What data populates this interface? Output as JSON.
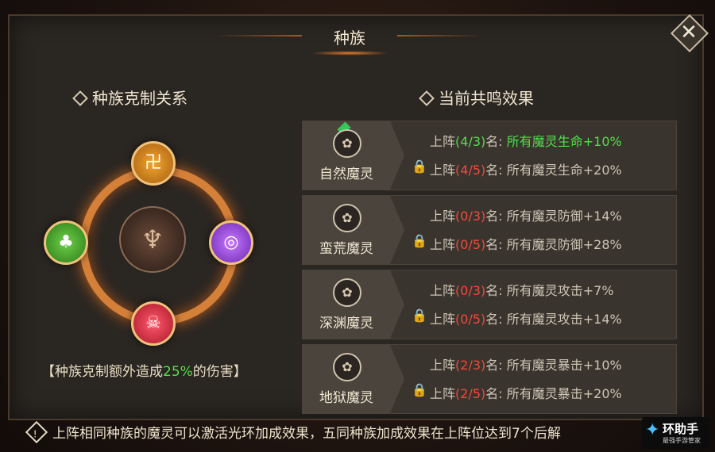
{
  "header": {
    "title": "种族",
    "close_icon": "✕"
  },
  "left_section": {
    "title": "种族克制关系",
    "nodes": [
      {
        "name": "top-race-node",
        "icon": "hell-icon",
        "glyph": "卍"
      },
      {
        "name": "left-race-node",
        "icon": "nature-icon",
        "glyph": "♣"
      },
      {
        "name": "right-race-node",
        "icon": "abyss-icon",
        "glyph": "◎"
      },
      {
        "name": "bottom-race-node",
        "icon": "skull-icon",
        "glyph": "☠"
      }
    ],
    "center_glyph": "♆",
    "note_prefix": "【种族克制额外造成",
    "note_highlight": "25%",
    "note_suffix": "的伤害】"
  },
  "right_section": {
    "title": "当前共鸣效果",
    "rows": [
      {
        "race": "自然魔灵",
        "l1_prefix": "上阵",
        "l1_count": "(4/3)",
        "l1_suffix": "名: ",
        "l1_text": "所有魔灵生命+10%",
        "l1_active": true,
        "l2_prefix": "上阵",
        "l2_count": "(4/5)",
        "l2_suffix": "名: ",
        "l2_text": "所有魔灵生命+20%"
      },
      {
        "race": "蛮荒魔灵",
        "l1_prefix": "上阵",
        "l1_count": "(0/3)",
        "l1_suffix": "名: ",
        "l1_text": "所有魔灵防御+14%",
        "l1_active": false,
        "l2_prefix": "上阵",
        "l2_count": "(0/5)",
        "l2_suffix": "名: ",
        "l2_text": "所有魔灵防御+28%"
      },
      {
        "race": "深渊魔灵",
        "l1_prefix": "上阵",
        "l1_count": "(0/3)",
        "l1_suffix": "名: ",
        "l1_text": "所有魔灵攻击+7%",
        "l1_active": false,
        "l2_prefix": "上阵",
        "l2_count": "(0/5)",
        "l2_suffix": "名: ",
        "l2_text": "所有魔灵攻击+14%"
      },
      {
        "race": "地狱魔灵",
        "l1_prefix": "上阵",
        "l1_count": "(2/3)",
        "l1_suffix": "名: ",
        "l1_text": "所有魔灵暴击+10%",
        "l1_active": false,
        "l2_prefix": "上阵",
        "l2_count": "(2/5)",
        "l2_suffix": "名: ",
        "l2_text": "所有魔灵暴击+20%"
      }
    ]
  },
  "footer": {
    "tip": "上阵相同种族的魔灵可以激活光环加成效果，五同种族加成效果在上阵位达到7个后解",
    "logo_main": "环助手",
    "logo_sub": "最强手游管家"
  }
}
